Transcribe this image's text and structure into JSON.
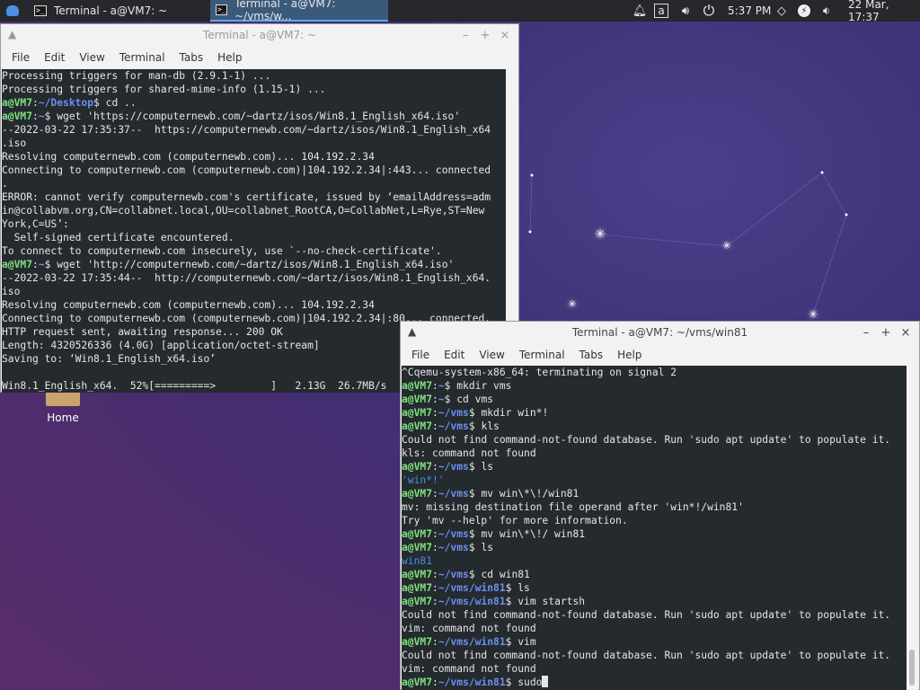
{
  "panel": {
    "tasks": [
      {
        "label": "Terminal - a@VM7: ~"
      },
      {
        "label": "Terminal - a@VM7: ~/vms/w..."
      }
    ],
    "clock": "5:37 PM",
    "date": "22 Mar, 17:37",
    "tray_icons": [
      "bell-icon",
      "keyboard-layout-icon",
      "volume-icon",
      "power-icon",
      "wifi-icon",
      "battery-icon",
      "speaker-icon"
    ],
    "keyboard_label": "a"
  },
  "desktop": {
    "home_label": "Home"
  },
  "window1": {
    "title": "Terminal - a@VM7: ~",
    "menu": [
      "File",
      "Edit",
      "View",
      "Terminal",
      "Tabs",
      "Help"
    ],
    "lines": [
      [
        [
          "t",
          "Processing triggers for man-db (2.9.1-1) ..."
        ]
      ],
      [
        [
          "t",
          "Processing triggers for shared-mime-info (1.15-1) ..."
        ]
      ],
      [
        [
          "g",
          "a@VM7"
        ],
        [
          "t",
          ":"
        ],
        [
          "b",
          "~/Desktop"
        ],
        [
          "t",
          "$ cd .."
        ]
      ],
      [
        [
          "g",
          "a@VM7"
        ],
        [
          "t",
          ":"
        ],
        [
          "b",
          "~"
        ],
        [
          "t",
          "$ wget 'https://computernewb.com/~dartz/isos/Win8.1_English_x64.iso'"
        ]
      ],
      [
        [
          "t",
          "--2022-03-22 17:35:37--  https://computernewb.com/~dartz/isos/Win8.1_English_x64"
        ]
      ],
      [
        [
          "t",
          ".iso"
        ]
      ],
      [
        [
          "t",
          "Resolving computernewb.com (computernewb.com)... 104.192.2.34"
        ]
      ],
      [
        [
          "t",
          "Connecting to computernewb.com (computernewb.com)|104.192.2.34|:443... connected"
        ]
      ],
      [
        [
          "t",
          "."
        ]
      ],
      [
        [
          "t",
          "ERROR: cannot verify computernewb.com's certificate, issued by ‘emailAddress=adm"
        ]
      ],
      [
        [
          "t",
          "in@collabvm.org,CN=collabnet.local,OU=collabnet_RootCA,O=CollabNet,L=Rye,ST=New"
        ]
      ],
      [
        [
          "t",
          "York,C=US’:"
        ]
      ],
      [
        [
          "t",
          "  Self-signed certificate encountered."
        ]
      ],
      [
        [
          "t",
          "To connect to computernewb.com insecurely, use `--no-check-certificate'."
        ]
      ],
      [
        [
          "g",
          "a@VM7"
        ],
        [
          "t",
          ":"
        ],
        [
          "b",
          "~"
        ],
        [
          "t",
          "$ wget 'http://computernewb.com/~dartz/isos/Win8.1_English_x64.iso'"
        ]
      ],
      [
        [
          "t",
          "--2022-03-22 17:35:44--  http://computernewb.com/~dartz/isos/Win8.1_English_x64."
        ]
      ],
      [
        [
          "t",
          "iso"
        ]
      ],
      [
        [
          "t",
          "Resolving computernewb.com (computernewb.com)... 104.192.2.34"
        ]
      ],
      [
        [
          "t",
          "Connecting to computernewb.com (computernewb.com)|104.192.2.34|:80... connected."
        ]
      ],
      [
        [
          "t",
          "HTTP request sent, awaiting response... 200 OK"
        ]
      ],
      [
        [
          "t",
          "Length: 4320526336 (4.0G) [application/octet-stream]"
        ]
      ],
      [
        [
          "t",
          "Saving to: ‘Win8.1_English_x64.iso’"
        ]
      ],
      [
        [
          "t",
          ""
        ]
      ],
      [
        [
          "t",
          "Win8.1_English_x64.  52%[=========>         ]   2.13G  26.7MB/s    eta 61s"
        ]
      ]
    ]
  },
  "window2": {
    "title": "Terminal - a@VM7: ~/vms/win81",
    "menu": [
      "File",
      "Edit",
      "View",
      "Terminal",
      "Tabs",
      "Help"
    ],
    "lines": [
      [
        [
          "t",
          "^Cqemu-system-x86_64: terminating on signal 2"
        ]
      ],
      [
        [
          "g",
          "a@VM7"
        ],
        [
          "t",
          ":"
        ],
        [
          "b",
          "~"
        ],
        [
          "t",
          "$ mkdir vms"
        ]
      ],
      [
        [
          "g",
          "a@VM7"
        ],
        [
          "t",
          ":"
        ],
        [
          "b",
          "~"
        ],
        [
          "t",
          "$ cd vms"
        ]
      ],
      [
        [
          "g",
          "a@VM7"
        ],
        [
          "t",
          ":"
        ],
        [
          "b",
          "~/vms"
        ],
        [
          "t",
          "$ mkdir win*!"
        ]
      ],
      [
        [
          "g",
          "a@VM7"
        ],
        [
          "t",
          ":"
        ],
        [
          "b",
          "~/vms"
        ],
        [
          "t",
          "$ kls"
        ]
      ],
      [
        [
          "t",
          "Could not find command-not-found database. Run 'sudo apt update' to populate it."
        ]
      ],
      [
        [
          "t",
          "kls: command not found"
        ]
      ],
      [
        [
          "g",
          "a@VM7"
        ],
        [
          "t",
          ":"
        ],
        [
          "b",
          "~/vms"
        ],
        [
          "t",
          "$ ls"
        ]
      ],
      [
        [
          "bl",
          "'win*!'"
        ]
      ],
      [
        [
          "g",
          "a@VM7"
        ],
        [
          "t",
          ":"
        ],
        [
          "b",
          "~/vms"
        ],
        [
          "t",
          "$ mv win\\*\\!/win81"
        ]
      ],
      [
        [
          "t",
          "mv: missing destination file operand after 'win*!/win81'"
        ]
      ],
      [
        [
          "t",
          "Try 'mv --help' for more information."
        ]
      ],
      [
        [
          "g",
          "a@VM7"
        ],
        [
          "t",
          ":"
        ],
        [
          "b",
          "~/vms"
        ],
        [
          "t",
          "$ mv win\\*\\!/ win81"
        ]
      ],
      [
        [
          "g",
          "a@VM7"
        ],
        [
          "t",
          ":"
        ],
        [
          "b",
          "~/vms"
        ],
        [
          "t",
          "$ ls"
        ]
      ],
      [
        [
          "bl",
          "win81"
        ]
      ],
      [
        [
          "g",
          "a@VM7"
        ],
        [
          "t",
          ":"
        ],
        [
          "b",
          "~/vms"
        ],
        [
          "t",
          "$ cd win81"
        ]
      ],
      [
        [
          "g",
          "a@VM7"
        ],
        [
          "t",
          ":"
        ],
        [
          "b",
          "~/vms/win81"
        ],
        [
          "t",
          "$ ls"
        ]
      ],
      [
        [
          "g",
          "a@VM7"
        ],
        [
          "t",
          ":"
        ],
        [
          "b",
          "~/vms/win81"
        ],
        [
          "t",
          "$ vim startsh"
        ]
      ],
      [
        [
          "t",
          "Could not find command-not-found database. Run 'sudo apt update' to populate it."
        ]
      ],
      [
        [
          "t",
          "vim: command not found"
        ]
      ],
      [
        [
          "g",
          "a@VM7"
        ],
        [
          "t",
          ":"
        ],
        [
          "b",
          "~/vms/win81"
        ],
        [
          "t",
          "$ vim"
        ]
      ],
      [
        [
          "t",
          "Could not find command-not-found database. Run 'sudo apt update' to populate it."
        ]
      ],
      [
        [
          "t",
          "vim: command not found"
        ]
      ],
      [
        [
          "g",
          "a@VM7"
        ],
        [
          "t",
          ":"
        ],
        [
          "b",
          "~/vms/win81"
        ],
        [
          "t",
          "$ sudo"
        ]
      ]
    ]
  }
}
